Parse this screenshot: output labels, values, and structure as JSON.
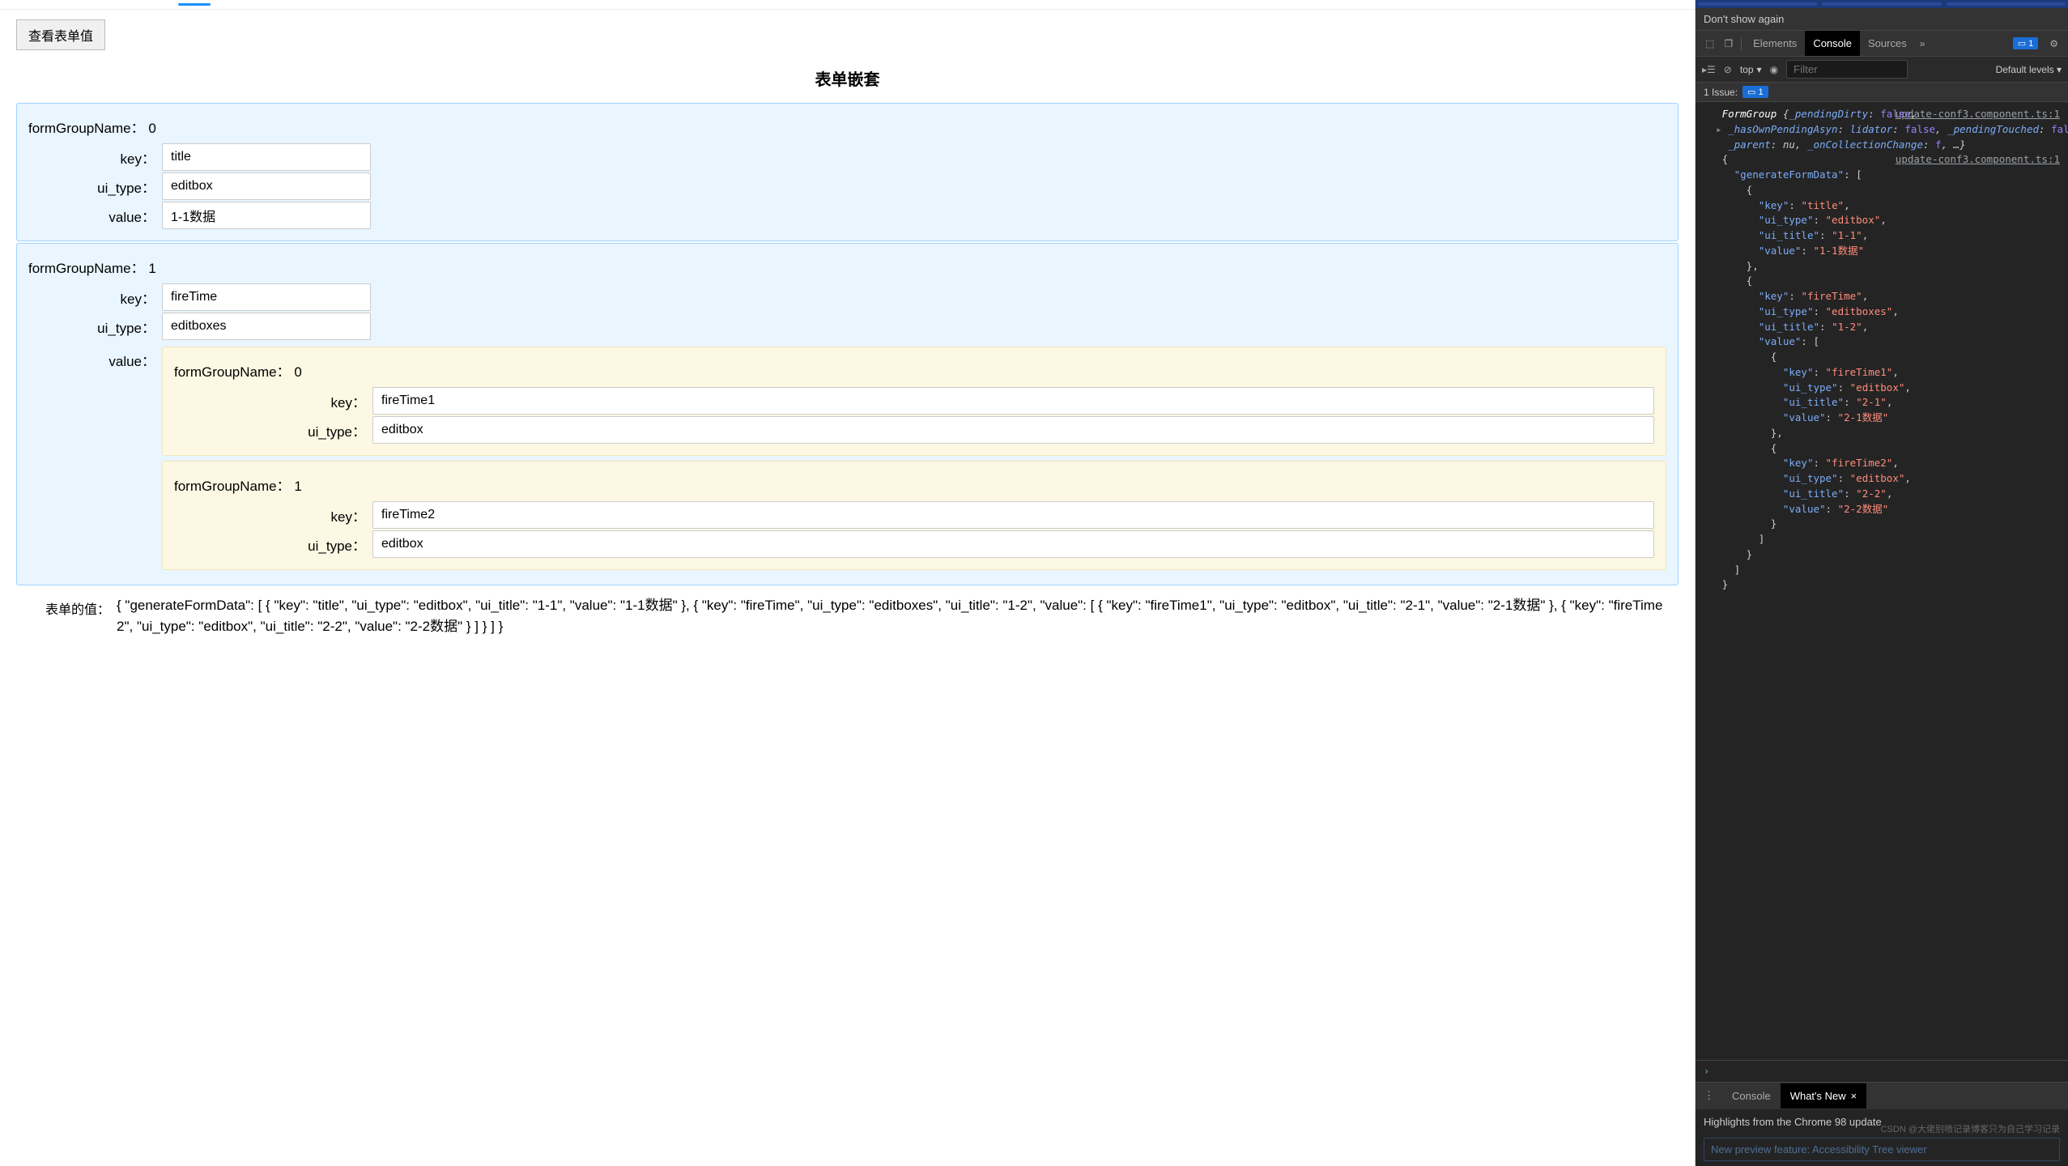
{
  "page": {
    "viewButton": "查看表单值",
    "title": "表单嵌套",
    "labels": {
      "formGroupName": "formGroupName：",
      "key": "key：",
      "ui_type": "ui_type：",
      "value": "value："
    },
    "groups": [
      {
        "index": "0",
        "fields": {
          "key": "title",
          "ui_type": "editbox",
          "value": "1-1数据"
        }
      },
      {
        "index": "1",
        "fields": {
          "key": "fireTime",
          "ui_type": "editboxes"
        },
        "nested": [
          {
            "index": "0",
            "fields": {
              "key": "fireTime1",
              "ui_type": "editbox"
            }
          },
          {
            "index": "1",
            "fields": {
              "key": "fireTime2",
              "ui_type": "editbox"
            }
          }
        ]
      }
    ],
    "footerLabel": "表单的值：",
    "footerJson": "{ \"generateFormData\": [ { \"key\": \"title\", \"ui_type\": \"editbox\", \"ui_title\": \"1-1\", \"value\": \"1-1数据\" }, { \"key\": \"fireTime\", \"ui_type\": \"editboxes\", \"ui_title\": \"1-2\", \"value\": [ { \"key\": \"fireTime1\", \"ui_type\": \"editbox\", \"ui_title\": \"2-1\", \"value\": \"2-1数据\" }, { \"key\": \"fireTime2\", \"ui_type\": \"editbox\", \"ui_title\": \"2-2\", \"value\": \"2-2数据\" } ] } ] }"
  },
  "devtools": {
    "infobar": "Don't show again",
    "tabs": {
      "elements": "Elements",
      "console": "Console",
      "sources": "Sources"
    },
    "badgeCount": "1",
    "toolbar": {
      "context": "top",
      "filterPlaceholder": "Filter",
      "levels": "Default levels"
    },
    "issues": {
      "label": "1 Issue:",
      "count": "1"
    },
    "srcLink": "update-conf3.component.ts:1",
    "formGroupLine": {
      "class": "FormGroup",
      "props": [
        {
          "k": "_pendingDirty",
          "v": "false"
        },
        {
          "k": "_hasOwnPendingAsyn"
        },
        {
          "k": "lidator",
          "v": "false"
        },
        {
          "k": "_pendingTouched",
          "v": "false"
        },
        {
          "k": "_parent",
          "v": "nu"
        },
        {
          "k": "_onCollectionChange",
          "v": "f"
        }
      ],
      "tail": ", …}"
    },
    "jsonDump": [
      "{",
      "  \"generateFormData\": [",
      "    {",
      "      \"key\": \"title\",",
      "      \"ui_type\": \"editbox\",",
      "      \"ui_title\": \"1-1\",",
      "      \"value\": \"1-1数据\"",
      "    },",
      "    {",
      "      \"key\": \"fireTime\",",
      "      \"ui_type\": \"editboxes\",",
      "      \"ui_title\": \"1-2\",",
      "      \"value\": [",
      "        {",
      "          \"key\": \"fireTime1\",",
      "          \"ui_type\": \"editbox\",",
      "          \"ui_title\": \"2-1\",",
      "          \"value\": \"2-1数据\"",
      "        },",
      "        {",
      "          \"key\": \"fireTime2\",",
      "          \"ui_type\": \"editbox\",",
      "          \"ui_title\": \"2-2\",",
      "          \"value\": \"2-2数据\"",
      "        }",
      "      ]",
      "    }",
      "  ]",
      "}"
    ],
    "bottomTabs": {
      "console": "Console",
      "whatsnew": "What's New"
    },
    "whatsnewText": "Highlights from the Chrome 98 update",
    "featureText": "New preview feature: Accessibility Tree viewer",
    "watermark": "CSDN @大佬别喷记录博客只为自己学习记录"
  }
}
